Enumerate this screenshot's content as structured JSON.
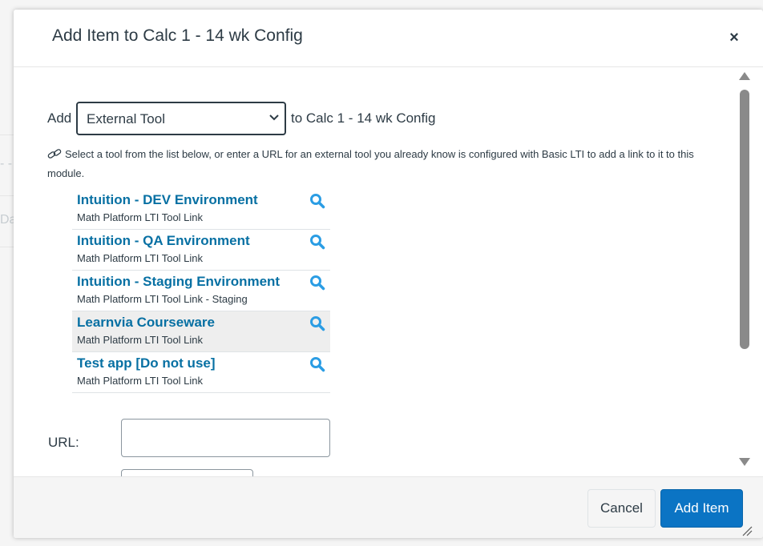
{
  "background": {
    "fragments": [
      "- -",
      "Da"
    ]
  },
  "dialog": {
    "title": "Add Item to Calc 1 - 14 wk Config",
    "close_glyph": "×"
  },
  "add_row": {
    "add_label": "Add",
    "selected_type": "External Tool",
    "to_label": "to Calc 1 - 14 wk Config"
  },
  "help_text": "Select a tool from the list below, or enter a URL for an external tool you already know is configured with Basic LTI to add a link to it to this module.",
  "tools": [
    {
      "name": "Intuition - DEV Environment",
      "desc": "Math Platform LTI Tool Link",
      "selected": false
    },
    {
      "name": "Intuition - QA Environment",
      "desc": "Math Platform LTI Tool Link",
      "selected": false
    },
    {
      "name": "Intuition - Staging Environment",
      "desc": "Math Platform LTI Tool Link - Staging",
      "selected": false
    },
    {
      "name": "Learnvia Courseware",
      "desc": "Math Platform LTI Tool Link",
      "selected": true
    },
    {
      "name": "Test app [Do not use]",
      "desc": "Math Platform LTI Tool Link",
      "selected": false
    }
  ],
  "url": {
    "label": "URL:",
    "value": "",
    "placeholder": ""
  },
  "footer": {
    "cancel_label": "Cancel",
    "add_label": "Add Item"
  },
  "colors": {
    "link": "#0770a3",
    "search_icon": "#2b9de4",
    "primary": "#0b74c4",
    "selected_row": "#eeeeee"
  },
  "icons": {
    "close": "close-icon",
    "link": "link-icon",
    "search": "search-icon",
    "select_arrow": "chevron-down-icon"
  }
}
